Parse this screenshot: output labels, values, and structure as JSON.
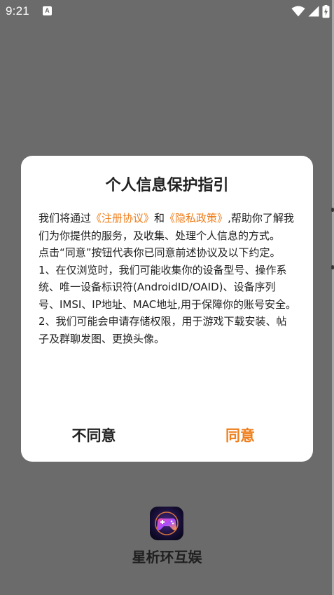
{
  "status_bar": {
    "time": "9:21",
    "app_icon_letter": "A",
    "icons": [
      "wifi-icon",
      "cell-signal-icon",
      "battery-charging-icon"
    ]
  },
  "dialog": {
    "title": "个人信息保护指引",
    "intro_before": "我们将通过",
    "link_terms": "《注册协议》",
    "intro_and": "和",
    "link_privacy": "《隐私政策》",
    "intro_after": ",帮助你了解我们为你提供的服务，及收集、处理个人信息的方式。",
    "para_agree": " 点击“同意”按钮代表你已同意前述协议及以下约定。",
    "para_1": " 1、在仅浏览时，我们可能收集你的设备型号、操作系统、唯一设备标识符(AndroidID/OAID)、设备序列号、IMSI、IP地址、MAC地址,用于保障你的账号安全。",
    "para_2": " 2、我们可能会申请存储权限，用于游戏下载安装、帖子及群聊发图、更换头像。",
    "disagree_label": "不同意",
    "agree_label": "同意",
    "accent_color": "#ef7d1a"
  },
  "app": {
    "name": "星析环互娱",
    "logo_icon": "gamepad-icon"
  }
}
